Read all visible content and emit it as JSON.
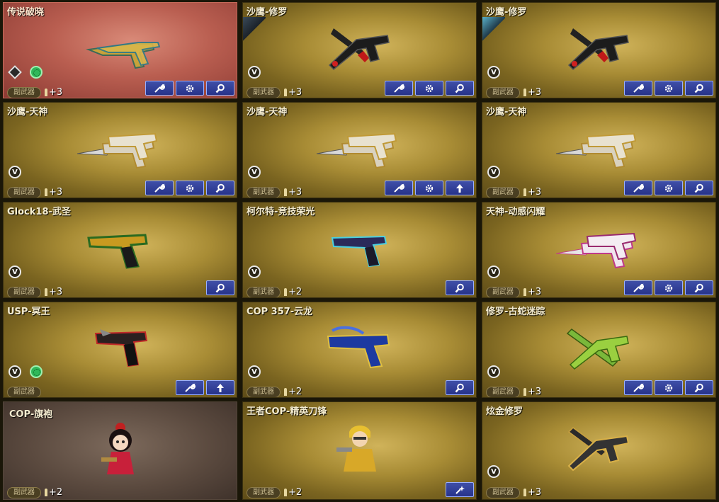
{
  "slot_label": "副武器",
  "cards": [
    {
      "title": "传说破晓",
      "ammo": "+3",
      "variant": "legend"
    },
    {
      "title": "沙鹰-修罗",
      "ammo": "+3"
    },
    {
      "title": "沙鹰-修罗",
      "ammo": "+3"
    },
    {
      "title": "沙鹰-天神",
      "ammo": "+3"
    },
    {
      "title": "沙鹰-天神",
      "ammo": "+3"
    },
    {
      "title": "沙鹰-天神",
      "ammo": "+3"
    },
    {
      "title": "Glock18-武圣",
      "ammo": "+3"
    },
    {
      "title": "柯尔特-竞技荣光",
      "ammo": "+2"
    },
    {
      "title": "天神-动感闪耀",
      "ammo": "+3"
    },
    {
      "title": "USP-冥王",
      "ammo": ""
    },
    {
      "title": "COP 357-云龙",
      "ammo": "+2"
    },
    {
      "title": "修罗-古蛇迷踪",
      "ammo": "+3"
    },
    {
      "title": "COP-旗袍",
      "ammo": "+2",
      "variant": "brown"
    },
    {
      "title": "王者COP-精英刀锋",
      "ammo": "+2"
    },
    {
      "title": "炫金修罗",
      "ammo": "+3"
    }
  ],
  "icons": {
    "wrench": "wrench-icon",
    "gear": "gear-icon",
    "search": "search-icon",
    "upgrade": "up-arrow-icon",
    "sparkle": "sparkle-icon"
  },
  "colors": {
    "card_gold": "#a88c35",
    "card_legend": "#b95e50",
    "card_brown": "#5b4a3f",
    "button_blue": "#27338a"
  }
}
